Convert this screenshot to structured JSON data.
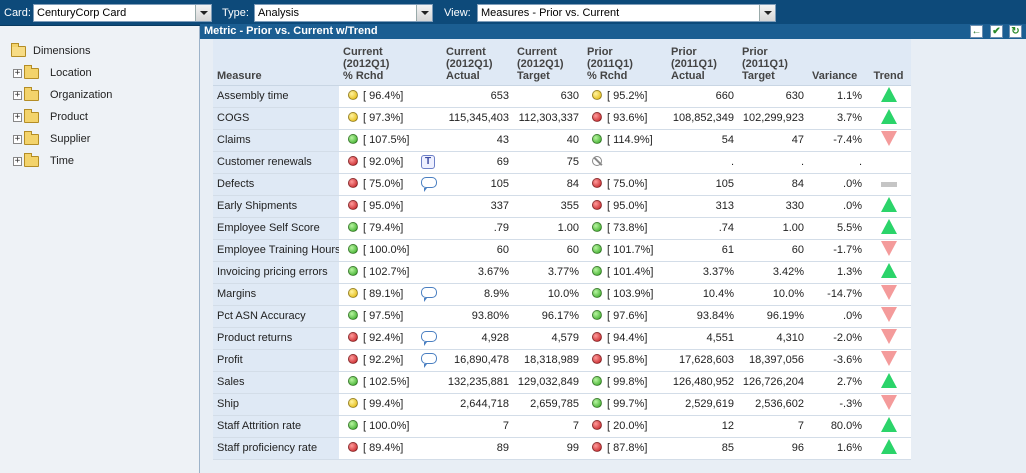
{
  "toolbar": {
    "card_label": "Card:",
    "card_value": "CenturyCorp Card",
    "type_label": "Type:",
    "type_value": "Analysis",
    "view_label": "View:",
    "view_value": "Measures - Prior vs. Current"
  },
  "tree": {
    "root": "Dimensions",
    "items": [
      "Location",
      "Organization",
      "Product",
      "Supplier",
      "Time"
    ]
  },
  "panel": {
    "title": "Metric - Prior vs. Current w/Trend"
  },
  "columns": {
    "measure": "Measure",
    "cur_pct": "Current\n(2012Q1)\n% Rchd",
    "cur_actual": "Current\n(2012Q1)\nActual",
    "cur_target": "Current\n(2012Q1)\nTarget",
    "prior_pct": "Prior\n(2011Q1)\n% Rchd",
    "prior_actual": "Prior\n(2011Q1)\nActual",
    "prior_target": "Prior\n(2011Q1)\nTarget",
    "variance": "Variance",
    "trend": "Trend"
  },
  "rows": [
    {
      "measure": "Assembly time",
      "cur_status": "yellow",
      "cur_pct": "[ 96.4%]",
      "note": "",
      "cur_actual": "653",
      "cur_target": "630",
      "prior_status": "yellow",
      "prior_pct": "[ 95.2%]",
      "prior_actual": "660",
      "prior_target": "630",
      "variance": "1.1%",
      "trend": "up"
    },
    {
      "measure": "COGS",
      "cur_status": "yellow",
      "cur_pct": "[ 97.3%]",
      "note": "",
      "cur_actual": "115,345,403",
      "cur_target": "112,303,337",
      "prior_status": "red",
      "prior_pct": "[ 93.6%]",
      "prior_actual": "108,852,349",
      "prior_target": "102,299,923",
      "variance": "3.7%",
      "trend": "up"
    },
    {
      "measure": "Claims",
      "cur_status": "green",
      "cur_pct": "[ 107.5%]",
      "note": "",
      "cur_actual": "43",
      "cur_target": "40",
      "prior_status": "green",
      "prior_pct": "[ 114.9%]",
      "prior_actual": "54",
      "prior_target": "47",
      "variance": "-7.4%",
      "trend": "down"
    },
    {
      "measure": "Customer renewals",
      "cur_status": "red",
      "cur_pct": "[ 92.0%]",
      "note": "text",
      "cur_actual": "69",
      "cur_target": "75",
      "prior_status": "none",
      "prior_pct": "",
      "prior_actual": ".",
      "prior_target": ".",
      "variance": ".",
      "trend": ""
    },
    {
      "measure": "Defects",
      "cur_status": "red",
      "cur_pct": "[ 75.0%]",
      "note": "comment",
      "cur_actual": "105",
      "cur_target": "84",
      "prior_status": "red",
      "prior_pct": "[ 75.0%]",
      "prior_actual": "105",
      "prior_target": "84",
      "variance": ".0%",
      "trend": "flat"
    },
    {
      "measure": "Early Shipments",
      "cur_status": "red",
      "cur_pct": "[ 95.0%]",
      "note": "",
      "cur_actual": "337",
      "cur_target": "355",
      "prior_status": "red",
      "prior_pct": "[ 95.0%]",
      "prior_actual": "313",
      "prior_target": "330",
      "variance": ".0%",
      "trend": "up"
    },
    {
      "measure": "Employee Self Score",
      "cur_status": "green",
      "cur_pct": "[ 79.4%]",
      "note": "",
      "cur_actual": ".79",
      "cur_target": "1.00",
      "prior_status": "green",
      "prior_pct": "[ 73.8%]",
      "prior_actual": ".74",
      "prior_target": "1.00",
      "variance": "5.5%",
      "trend": "up"
    },
    {
      "measure": "Employee Training Hours",
      "cur_status": "green",
      "cur_pct": "[ 100.0%]",
      "note": "",
      "cur_actual": "60",
      "cur_target": "60",
      "prior_status": "green",
      "prior_pct": "[ 101.7%]",
      "prior_actual": "61",
      "prior_target": "60",
      "variance": "-1.7%",
      "trend": "down"
    },
    {
      "measure": "Invoicing pricing errors",
      "cur_status": "green",
      "cur_pct": "[ 102.7%]",
      "note": "",
      "cur_actual": "3.67%",
      "cur_target": "3.77%",
      "prior_status": "green",
      "prior_pct": "[ 101.4%]",
      "prior_actual": "3.37%",
      "prior_target": "3.42%",
      "variance": "1.3%",
      "trend": "up"
    },
    {
      "measure": "Margins",
      "cur_status": "yellow",
      "cur_pct": "[ 89.1%]",
      "note": "comment",
      "cur_actual": "8.9%",
      "cur_target": "10.0%",
      "prior_status": "green",
      "prior_pct": "[ 103.9%]",
      "prior_actual": "10.4%",
      "prior_target": "10.0%",
      "variance": "-14.7%",
      "trend": "down"
    },
    {
      "measure": "Pct ASN Accuracy",
      "cur_status": "green",
      "cur_pct": "[ 97.5%]",
      "note": "",
      "cur_actual": "93.80%",
      "cur_target": "96.17%",
      "prior_status": "green",
      "prior_pct": "[ 97.6%]",
      "prior_actual": "93.84%",
      "prior_target": "96.19%",
      "variance": ".0%",
      "trend": "down"
    },
    {
      "measure": "Product returns",
      "cur_status": "red",
      "cur_pct": "[ 92.4%]",
      "note": "comment",
      "cur_actual": "4,928",
      "cur_target": "4,579",
      "prior_status": "red",
      "prior_pct": "[ 94.4%]",
      "prior_actual": "4,551",
      "prior_target": "4,310",
      "variance": "-2.0%",
      "trend": "down"
    },
    {
      "measure": "Profit",
      "cur_status": "red",
      "cur_pct": "[ 92.2%]",
      "note": "comment",
      "cur_actual": "16,890,478",
      "cur_target": "18,318,989",
      "prior_status": "red",
      "prior_pct": "[ 95.8%]",
      "prior_actual": "17,628,603",
      "prior_target": "18,397,056",
      "variance": "-3.6%",
      "trend": "down"
    },
    {
      "measure": "Sales",
      "cur_status": "green",
      "cur_pct": "[ 102.5%]",
      "note": "",
      "cur_actual": "132,235,881",
      "cur_target": "129,032,849",
      "prior_status": "green",
      "prior_pct": "[ 99.8%]",
      "prior_actual": "126,480,952",
      "prior_target": "126,726,204",
      "variance": "2.7%",
      "trend": "up"
    },
    {
      "measure": "Ship",
      "cur_status": "yellow",
      "cur_pct": "[ 99.4%]",
      "note": "",
      "cur_actual": "2,644,718",
      "cur_target": "2,659,785",
      "prior_status": "green",
      "prior_pct": "[ 99.7%]",
      "prior_actual": "2,529,619",
      "prior_target": "2,536,602",
      "variance": "-.3%",
      "trend": "down"
    },
    {
      "measure": "Staff Attrition rate",
      "cur_status": "green",
      "cur_pct": "[ 100.0%]",
      "note": "",
      "cur_actual": "7",
      "cur_target": "7",
      "prior_status": "red",
      "prior_pct": "[ 20.0%]",
      "prior_actual": "12",
      "prior_target": "7",
      "variance": "80.0%",
      "trend": "up"
    },
    {
      "measure": "Staff proficiency rate",
      "cur_status": "red",
      "cur_pct": "[ 89.4%]",
      "note": "",
      "cur_actual": "89",
      "cur_target": "99",
      "prior_status": "red",
      "prior_pct": "[ 87.8%]",
      "prior_actual": "85",
      "prior_target": "96",
      "variance": "1.6%",
      "trend": "up"
    }
  ],
  "note_icon_text": "T",
  "colors": {
    "toolbar_bg": "#0d4a7a",
    "panel_header_bg": "#1b5e92",
    "status_green": "#2fa51d",
    "status_yellow": "#e2b400",
    "status_red": "#c0181c",
    "trend_up": "#2bd46a",
    "trend_down": "#f49b9b"
  }
}
